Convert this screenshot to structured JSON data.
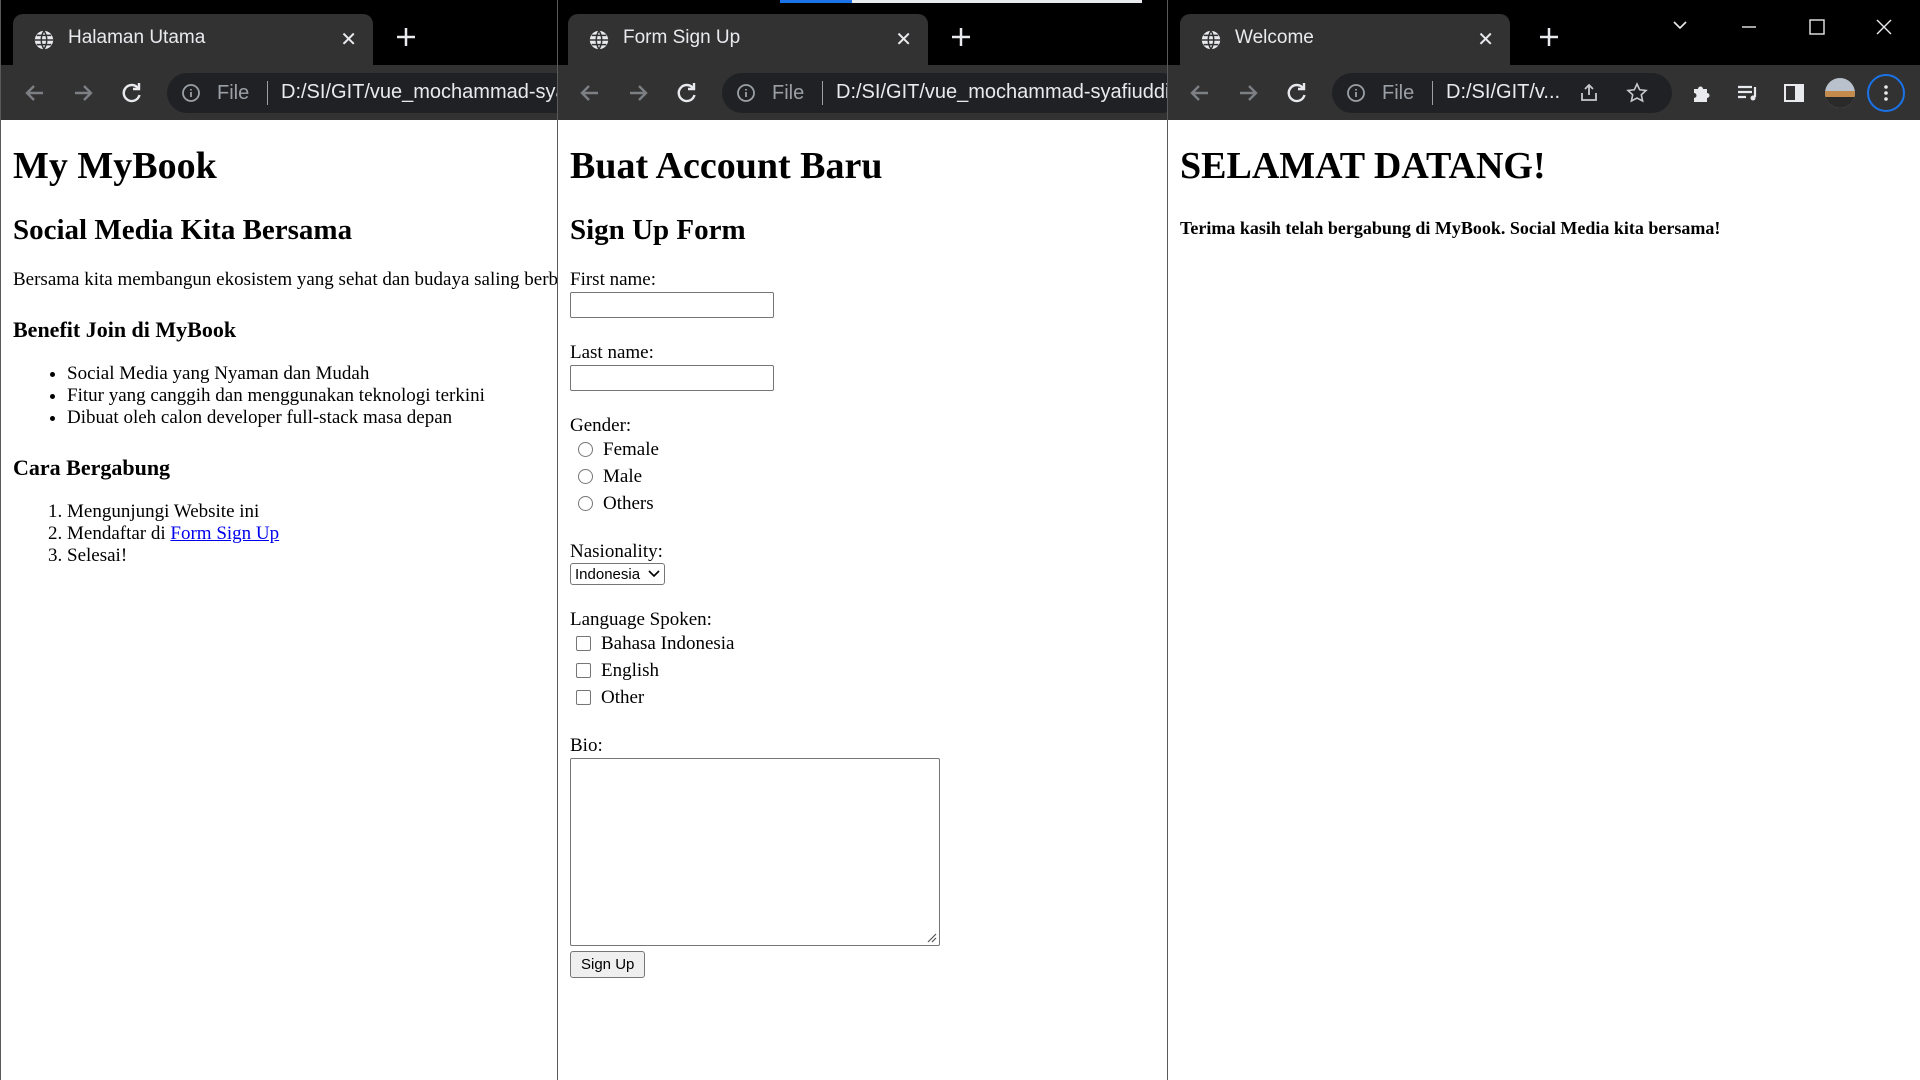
{
  "windows": [
    {
      "tab_title": "Halaman Utama",
      "scheme_label": "File",
      "url": "D:/SI/GIT/vue_mochammad-syafiuddin/index.html",
      "page": {
        "h1": "My MyBook",
        "h2": "Social Media Kita Bersama",
        "intro": "Bersama kita membangun ekosistem yang sehat dan budaya saling berbagi",
        "benefit_heading": "Benefit Join di MyBook",
        "benefits": [
          "Social Media yang Nyaman dan Mudah",
          "Fitur yang canggih dan menggunakan teknologi terkini",
          "Dibuat oleh calon developer full-stack masa depan"
        ],
        "join_heading": "Cara Bergabung",
        "steps": {
          "step1": "Mengunjungi Website ini",
          "step2_prefix": "Mendaftar di ",
          "step2_link": "Form Sign Up",
          "step3": "Selesai!"
        }
      }
    },
    {
      "tab_title": "Form Sign Up",
      "scheme_label": "File",
      "url": "D:/SI/GIT/vue_mochammad-syafiuddin/signup.html",
      "page": {
        "h1": "Buat Account Baru",
        "h2": "Sign Up Form",
        "first_name_label": "First name:",
        "last_name_label": "Last name:",
        "gender_label": "Gender:",
        "gender_options": [
          "Female",
          "Male",
          "Others"
        ],
        "nationality_label": "Nasionality:",
        "nationality_selected": "Indonesia",
        "language_label": "Language Spoken:",
        "language_options": [
          "Bahasa Indonesia",
          "English",
          "Other"
        ],
        "bio_label": "Bio:",
        "submit_label": "Sign Up"
      }
    },
    {
      "tab_title": "Welcome",
      "scheme_label": "File",
      "url": "D:/SI/GIT/v...",
      "page": {
        "h1": "SELAMAT DATANG!",
        "message": "Terima kasih telah bergabung di MyBook. Social Media kita bersama!"
      }
    }
  ],
  "colors": {
    "tabstrip": "#000000",
    "active_tab": "#323232",
    "toolbar": "#323232",
    "omnibox": "#202124",
    "link": "#0000ee",
    "accent_blue": "#1a73e8"
  },
  "icons": {
    "tab": "globe-icon",
    "new_tab": "plus-icon",
    "back": "arrow-left-icon",
    "forward": "arrow-right-icon",
    "reload": "reload-icon",
    "site_info": "info-icon",
    "share": "share-icon",
    "bookmark": "star-icon",
    "extensions": "puzzle-icon",
    "media": "media-queue-icon",
    "side_panel": "side-panel-icon",
    "profile": "avatar",
    "menu": "kebab-menu-icon",
    "tab_search": "chevron-down-icon",
    "minimize": "minimize-icon",
    "maximize": "maximize-icon",
    "close": "close-icon"
  }
}
